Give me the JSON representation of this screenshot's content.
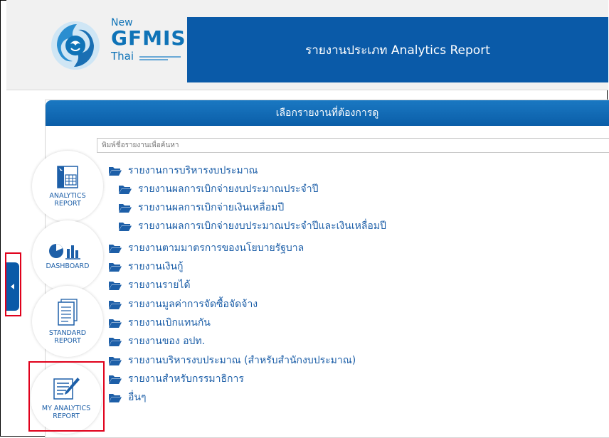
{
  "header": {
    "logo_new": "New",
    "logo_gfmis": "GFMIS",
    "logo_thai": "Thai",
    "title": "รายงานประเภท Analytics Report"
  },
  "panel": {
    "title": "เลือกรายงานที่ต้องการดู",
    "search_placeholder": "พิมพ์ชื่อรายงานเพื่อค้นหา"
  },
  "tree": {
    "items": [
      {
        "label": "รายงานการบริหารงบประมาณ"
      },
      {
        "label": "รายงานผลการเบิกจ่ายงบประมาณประจำปี"
      },
      {
        "label": "รายงานผลการเบิกจ่ายเงินเหลื่อมปี"
      },
      {
        "label": "รายงานผลการเบิกจ่ายงบประมาณประจำปีและเงินเหลื่อมปี"
      },
      {
        "label": "รายงานตามมาตรการของนโยบายรัฐบาล"
      },
      {
        "label": "รายงานเงินกู้"
      },
      {
        "label": "รายงานรายได้"
      },
      {
        "label": "รายงานมูลค่าการจัดซื้อจัดจ้าง"
      },
      {
        "label": "รายงานเบิกแทนกัน"
      },
      {
        "label": "รายงานของ อปท."
      },
      {
        "label": "รายงานบริหารงบประมาณ (สำหรับสำนักงบประมาณ)"
      },
      {
        "label": "รายงานสำหรับกรรมาธิการ"
      },
      {
        "label": "อื่นๆ"
      }
    ]
  },
  "sidebar": {
    "analytics_l1": "ANALYTICS",
    "analytics_l2": "REPORT",
    "dashboard": "DASHBOARD",
    "standard_l1": "STANDARD",
    "standard_l2": "REPORT",
    "my_l1": "MY ANALYTICS",
    "my_l2": "REPORT"
  },
  "colors": {
    "brand_blue": "#0a5aa8",
    "link_blue": "#1d5fa8",
    "highlight_red": "#e0001b"
  },
  "icons": [
    "folder-icon",
    "analytics-report-icon",
    "dashboard-icon",
    "standard-report-icon",
    "my-analytics-report-icon",
    "collapse-arrow-icon",
    "logo-emblem-icon"
  ]
}
